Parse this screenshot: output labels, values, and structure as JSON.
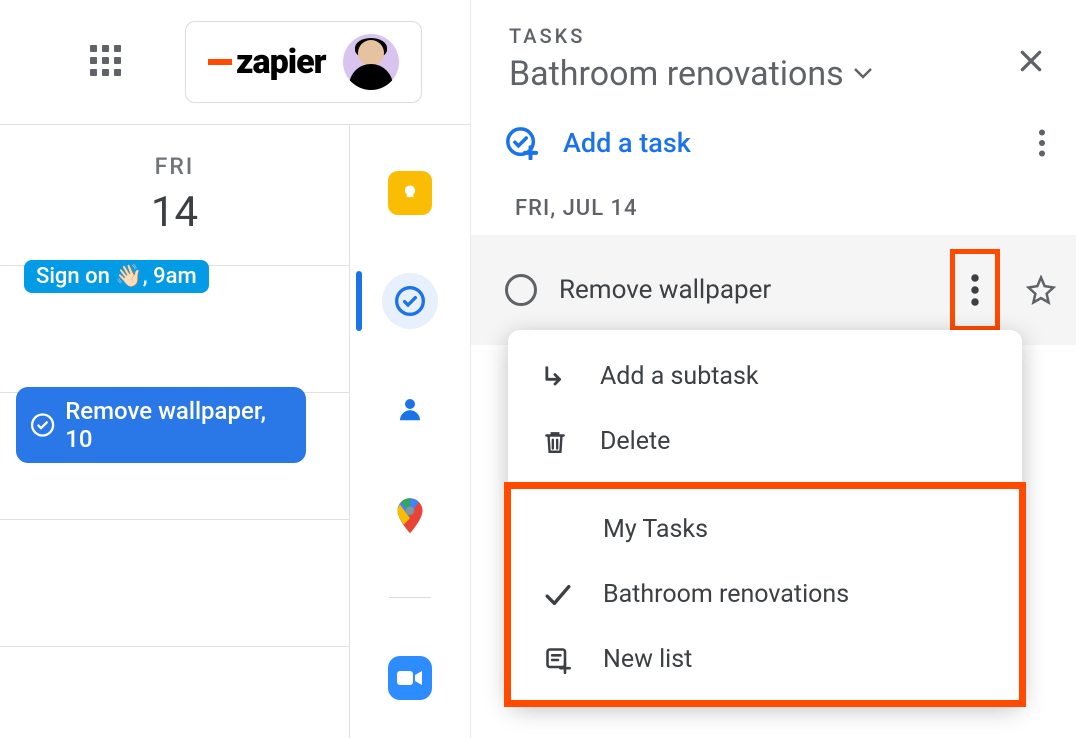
{
  "brand": {
    "name": "zapier"
  },
  "calendar": {
    "dow": "FRI",
    "date": "14",
    "event1": "Sign on 👋🏻, 9am",
    "event2": "Remove wallpaper, 10"
  },
  "tasks": {
    "eyebrow": "TASKS",
    "listName": "Bathroom renovations",
    "addLabel": "Add a task",
    "dateLabel": "FRI, JUL 14",
    "task1": "Remove wallpaper"
  },
  "menu": {
    "addSubtask": "Add a subtask",
    "delete": "Delete",
    "myTasks": "My Tasks",
    "bathroom": "Bathroom renovations",
    "newList": "New list"
  }
}
